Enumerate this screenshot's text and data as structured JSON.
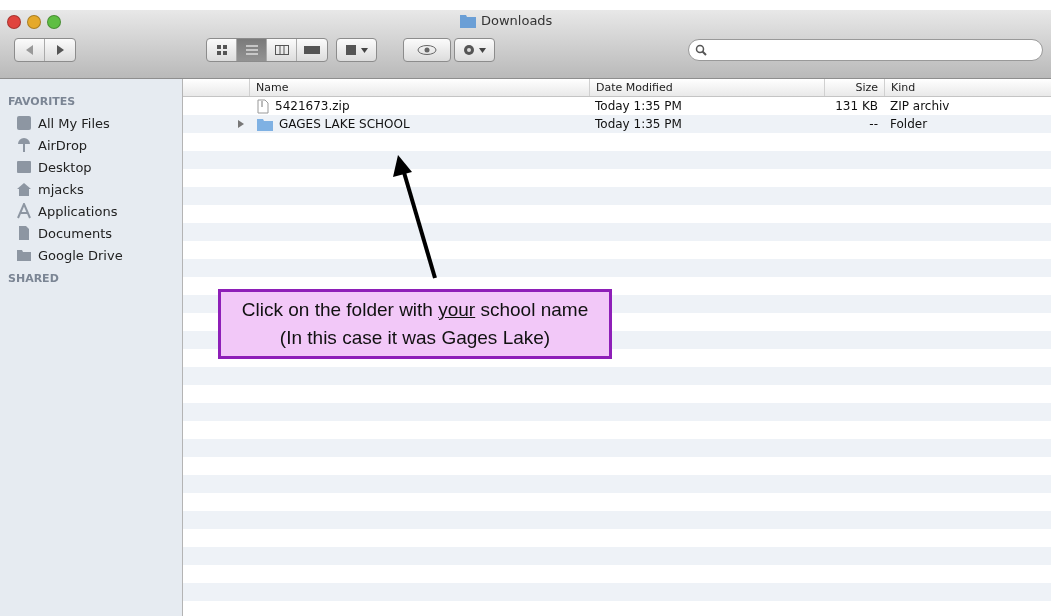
{
  "window": {
    "title": "Downloads"
  },
  "toolbar": {
    "view_modes": [
      {
        "kind": "icons",
        "selected": false
      },
      {
        "kind": "list",
        "selected": true
      },
      {
        "kind": "columns",
        "selected": false
      },
      {
        "kind": "coverflow",
        "selected": false
      }
    ]
  },
  "sidebar": {
    "sections": [
      {
        "heading": "FAVORITES",
        "items": [
          {
            "label": "All My Files",
            "kind": "files"
          },
          {
            "label": "AirDrop",
            "kind": "airdrop"
          },
          {
            "label": "Desktop",
            "kind": "desktop"
          },
          {
            "label": "mjacks",
            "kind": "home"
          },
          {
            "label": "Applications",
            "kind": "apps"
          },
          {
            "label": "Documents",
            "kind": "documents"
          },
          {
            "label": "Google Drive",
            "kind": "folder"
          }
        ]
      },
      {
        "heading": "SHARED"
      }
    ]
  },
  "table": {
    "columns": [
      "Name",
      "Date Modified",
      "Size",
      "Kind"
    ],
    "rows": [
      {
        "kind": "file",
        "name": "5421673.zip",
        "date": "Today 1:35 PM",
        "size": "131 KB",
        "type": "ZIP archiv"
      },
      {
        "kind": "folder",
        "name": "GAGES LAKE SCHOOL",
        "date": "Today 1:35 PM",
        "size": "--",
        "type": "Folder",
        "expanded": false
      }
    ]
  },
  "callout": {
    "before": "Click on the folder with ",
    "underlined": "your",
    "after": " school name (In this case it was Gages Lake)"
  }
}
